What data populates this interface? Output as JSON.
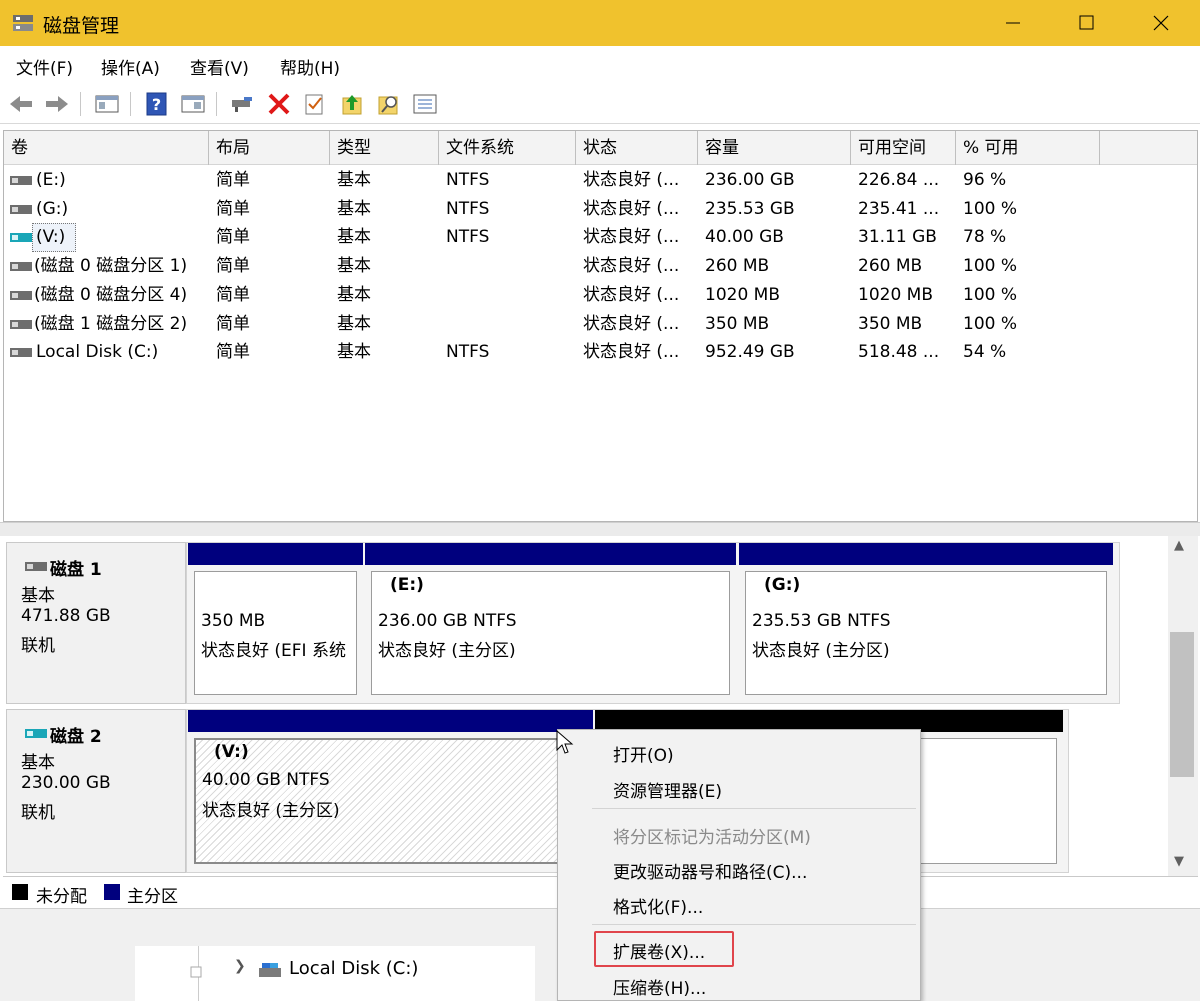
{
  "window": {
    "title": "磁盘管理"
  },
  "menu": [
    "文件(F)",
    "操作(A)",
    "查看(V)",
    "帮助(H)"
  ],
  "toolbar": {
    "icons": [
      "back-arrow-icon",
      "forward-arrow-icon",
      "show-hide-console-icon",
      "help-icon",
      "properties-icon",
      "connect-drive-icon",
      "delete-icon",
      "check-icon",
      "up-arrow-icon",
      "search-icon",
      "list-icon"
    ]
  },
  "volume_list": {
    "columns": [
      "卷",
      "布局",
      "类型",
      "文件系统",
      "状态",
      "容量",
      "可用空间",
      "% 可用"
    ],
    "rows": [
      {
        "vol": "(E:)",
        "layout": "简单",
        "type": "基本",
        "fs": "NTFS",
        "status": "状态良好 (...",
        "cap": "236.00 GB",
        "free": "226.84 ...",
        "pct": "96 %"
      },
      {
        "vol": "(G:)",
        "layout": "简单",
        "type": "基本",
        "fs": "NTFS",
        "status": "状态良好 (...",
        "cap": "235.53 GB",
        "free": "235.41 ...",
        "pct": "100 %"
      },
      {
        "vol": "(V:)",
        "layout": "简单",
        "type": "基本",
        "fs": "NTFS",
        "status": "状态良好 (...",
        "cap": "40.00 GB",
        "free": "31.11 GB",
        "pct": "78 %"
      },
      {
        "vol": "(磁盘 0 磁盘分区 1)",
        "layout": "简单",
        "type": "基本",
        "fs": "",
        "status": "状态良好 (...",
        "cap": "260 MB",
        "free": "260 MB",
        "pct": "100 %"
      },
      {
        "vol": "(磁盘 0 磁盘分区 4)",
        "layout": "简单",
        "type": "基本",
        "fs": "",
        "status": "状态良好 (...",
        "cap": "1020 MB",
        "free": "1020 MB",
        "pct": "100 %"
      },
      {
        "vol": "(磁盘 1 磁盘分区 2)",
        "layout": "简单",
        "type": "基本",
        "fs": "",
        "status": "状态良好 (...",
        "cap": "350 MB",
        "free": "350 MB",
        "pct": "100 %"
      },
      {
        "vol": "Local Disk (C:)",
        "layout": "简单",
        "type": "基本",
        "fs": "NTFS",
        "status": "状态良好 (...",
        "cap": "952.49 GB",
        "free": "518.48 ...",
        "pct": "54 %"
      }
    ]
  },
  "disks": [
    {
      "name": "磁盘 1",
      "type": "基本",
      "size": "471.88 GB",
      "state": "联机",
      "partitions": [
        {
          "label": "",
          "size": "350 MB",
          "status": "状态良好 (EFI 系统"
        },
        {
          "label": "(E:)",
          "size": "236.00 GB NTFS",
          "status": "状态良好 (主分区)"
        },
        {
          "label": "(G:)",
          "size": "235.53 GB NTFS",
          "status": "状态良好 (主分区)"
        }
      ]
    },
    {
      "name": "磁盘 2",
      "type": "基本",
      "size": "230.00 GB",
      "state": "联机",
      "partitions": [
        {
          "label": "(V:)",
          "size": "40.00 GB NTFS",
          "status": "状态良好 (主分区)"
        }
      ]
    }
  ],
  "legend": [
    {
      "label": "未分配",
      "color": "#000000"
    },
    {
      "label": "主分区",
      "color": "#00007e"
    }
  ],
  "context_menu": {
    "items": [
      {
        "label": "打开(O)",
        "enabled": true
      },
      {
        "label": "资源管理器(E)",
        "enabled": true
      },
      {
        "label": "将分区标记为活动分区(M)",
        "enabled": false
      },
      {
        "label": "更改驱动器号和路径(C)...",
        "enabled": true
      },
      {
        "label": "格式化(F)...",
        "enabled": true
      },
      {
        "label": "扩展卷(X)...",
        "enabled": true,
        "highlighted": true
      },
      {
        "label": "压缩卷(H)...",
        "enabled": true
      }
    ]
  },
  "background_window": {
    "tree_item": "Local Disk (C:)"
  },
  "colors": {
    "titlebar": "#f0c22d",
    "primary_partition": "#00007e",
    "unallocated": "#000000",
    "highlight_box": "#e0454c"
  }
}
